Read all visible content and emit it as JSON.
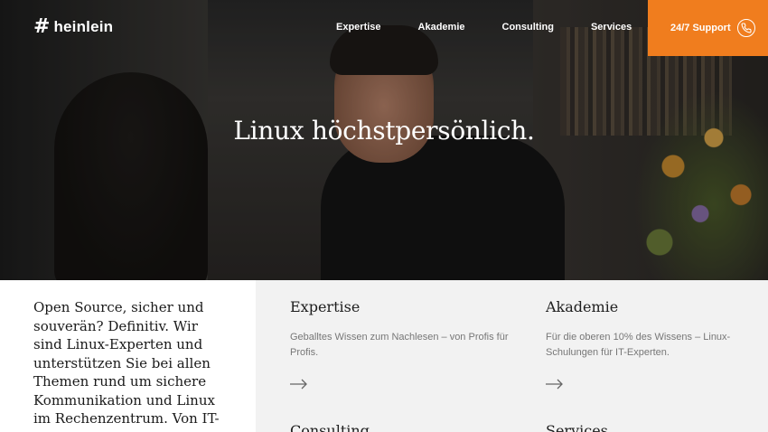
{
  "header": {
    "logo_mark": "#",
    "logo_word": "heinlein",
    "nav": [
      "Expertise",
      "Akademie",
      "Consulting",
      "Services"
    ],
    "support_label": "24/7 Support",
    "support_icon": "phone-icon",
    "accent_color": "#f07d1e"
  },
  "hero": {
    "title": "Linux höchstpersönlich."
  },
  "intro": {
    "text": "Open Source, sicher und souverän? Definitiv. Wir sind Linux-Experten und unterstützen Sie bei allen Themen rund um sichere Kommunikation und Linux im Rechenzentrum. Von IT-Infrastruktur bis IT-"
  },
  "cards": [
    {
      "title": "Expertise",
      "desc": "Geballtes Wissen zum Nachlesen – von Profis für Profis.",
      "icon": "arrow-right-icon"
    },
    {
      "title": "Akademie",
      "desc": "Für die oberen 10% des Wissens – Linux-Schulungen für IT-Experten.",
      "icon": "arrow-right-icon"
    },
    {
      "title": "Consulting",
      "desc": "",
      "icon": "arrow-right-icon"
    },
    {
      "title": "Services",
      "desc": "",
      "icon": "arrow-right-icon"
    }
  ]
}
